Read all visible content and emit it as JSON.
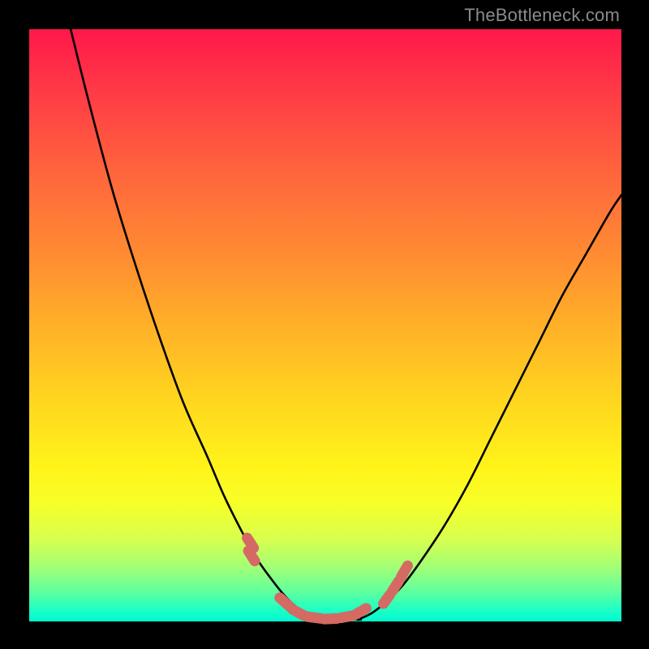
{
  "watermark": "TheBottleneck.com",
  "chart_data": {
    "type": "line",
    "title": "",
    "xlabel": "",
    "ylabel": "",
    "xlim": [
      0,
      100
    ],
    "ylim": [
      0,
      100
    ],
    "grid": false,
    "left_curve": {
      "x": [
        7,
        10,
        14,
        18,
        22,
        26,
        30,
        33,
        36,
        38.5,
        41,
        43,
        45,
        46.5,
        48
      ],
      "y": [
        100,
        88,
        73,
        60,
        48,
        37,
        28,
        21,
        15,
        10.5,
        7,
        4.5,
        2.5,
        1.2,
        0.5
      ]
    },
    "right_curve": {
      "x": [
        56,
        58,
        60.5,
        63,
        66,
        70,
        74,
        78,
        82,
        86,
        90,
        94,
        98,
        100
      ],
      "y": [
        0.5,
        1.5,
        3.5,
        6,
        10,
        16,
        23,
        31,
        39,
        47,
        55,
        62,
        69,
        72
      ]
    },
    "valley_floor": {
      "x": [
        48,
        56
      ],
      "y": [
        0.3,
        0.3
      ]
    },
    "dash_segments_left": [
      {
        "x": [
          36.8,
          37.9
        ],
        "y": [
          14.1,
          12.4
        ]
      },
      {
        "x": [
          37.0,
          38.1
        ],
        "y": [
          11.9,
          10.2
        ]
      }
    ],
    "dash_segments_right": [
      {
        "x": [
          59.8,
          60.9
        ],
        "y": [
          3.0,
          4.5
        ]
      },
      {
        "x": [
          61.3,
          62.4
        ],
        "y": [
          5.1,
          6.8
        ]
      },
      {
        "x": [
          62.8,
          63.9
        ],
        "y": [
          7.5,
          9.4
        ]
      }
    ],
    "dash_bottom": [
      {
        "x": [
          42.3,
          44.0
        ],
        "y": [
          4.0,
          2.5
        ]
      },
      {
        "x": [
          44.5,
          46.4
        ],
        "y": [
          2.0,
          1.0
        ]
      },
      {
        "x": [
          47.0,
          49.2
        ],
        "y": [
          0.8,
          0.5
        ]
      },
      {
        "x": [
          49.8,
          52.0
        ],
        "y": [
          0.4,
          0.5
        ]
      },
      {
        "x": [
          52.6,
          54.8
        ],
        "y": [
          0.6,
          1.0
        ]
      },
      {
        "x": [
          55.3,
          56.9
        ],
        "y": [
          1.3,
          2.2
        ]
      }
    ],
    "colors": {
      "curve_stroke": "#000000",
      "dash_stroke": "#d46a63"
    }
  }
}
